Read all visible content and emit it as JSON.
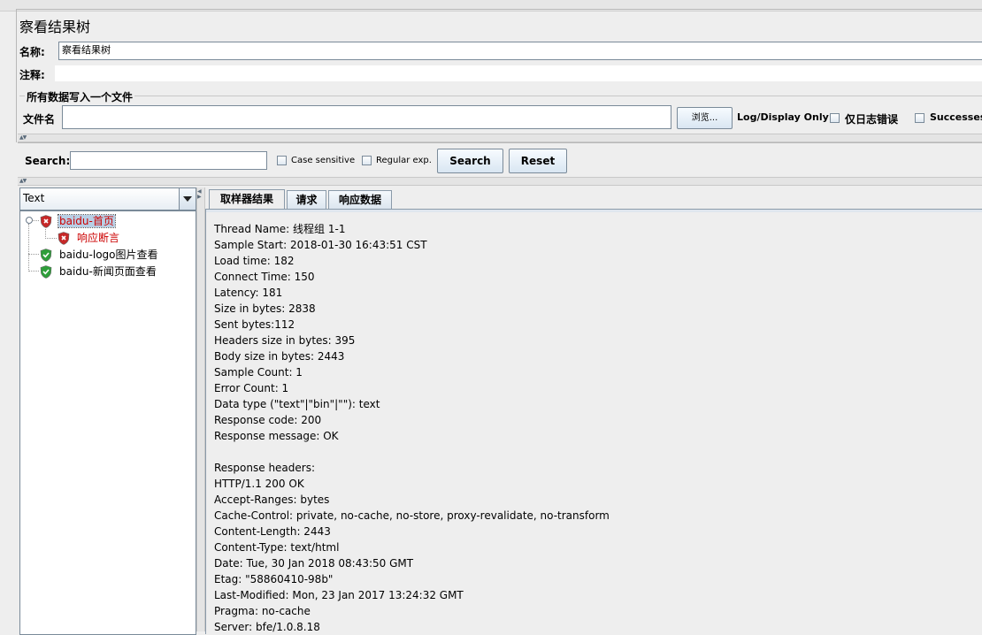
{
  "panel": {
    "title": "察看结果树",
    "name_label": "名称:",
    "name_value": "察看结果树",
    "comment_label": "注释:",
    "comment_value": ""
  },
  "file_group": {
    "legend": "所有数据写入一个文件",
    "filename_label": "文件名",
    "filename_value": "",
    "browse_label": "浏览...",
    "log_display_label": "Log/Display Only:",
    "errors_only_label": "仅日志错误",
    "successes_label": "Successes"
  },
  "search": {
    "label": "Search:",
    "value": "",
    "case_sensitive_label": "Case sensitive",
    "regex_label": "Regular exp.",
    "search_button": "Search",
    "reset_button": "Reset"
  },
  "renderer": {
    "selected": "Text"
  },
  "tree": [
    {
      "label": "baidu-首页",
      "status": "error",
      "level": 0,
      "selected": true
    },
    {
      "label": "响应断言",
      "status": "error",
      "level": 1,
      "selected": false
    },
    {
      "label": "baidu-logo图片查看",
      "status": "success",
      "level": 0,
      "selected": false
    },
    {
      "label": "baidu-新闻页面查看",
      "status": "success",
      "level": 0,
      "selected": false
    }
  ],
  "tabs": [
    {
      "label": "取样器结果",
      "active": true
    },
    {
      "label": "请求",
      "active": false
    },
    {
      "label": "响应数据",
      "active": false
    }
  ],
  "result_lines": [
    "Thread Name: 线程组 1-1",
    "Sample Start: 2018-01-30 16:43:51 CST",
    "Load time: 182",
    "Connect Time: 150",
    "Latency: 181",
    "Size in bytes: 2838",
    "Sent bytes:112",
    "Headers size in bytes: 395",
    "Body size in bytes: 2443",
    "Sample Count: 1",
    "Error Count: 1",
    "Data type (\"text\"|\"bin\"|\"\"): text",
    "Response code: 200",
    "Response message: OK",
    "",
    "Response headers:",
    "HTTP/1.1 200 OK",
    "Accept-Ranges: bytes",
    "Cache-Control: private, no-cache, no-store, proxy-revalidate, no-transform",
    "Content-Length: 2443",
    "Content-Type: text/html",
    "Date: Tue, 30 Jan 2018 08:43:50 GMT",
    "Etag: \"58860410-98b\"",
    "Last-Modified: Mon, 23 Jan 2017 13:24:32 GMT",
    "Pragma: no-cache",
    "Server: bfe/1.0.8.18"
  ],
  "colors": {
    "error_text": "#cc0000",
    "error_shield": "#c62828",
    "success_shield": "#2e9e3a",
    "selection_bg": "#b8cfe5"
  },
  "icons": {
    "error": "error-shield-icon",
    "success": "success-shield-icon",
    "dropdown": "chevron-down-icon",
    "expand": "tree-expand-icon"
  }
}
